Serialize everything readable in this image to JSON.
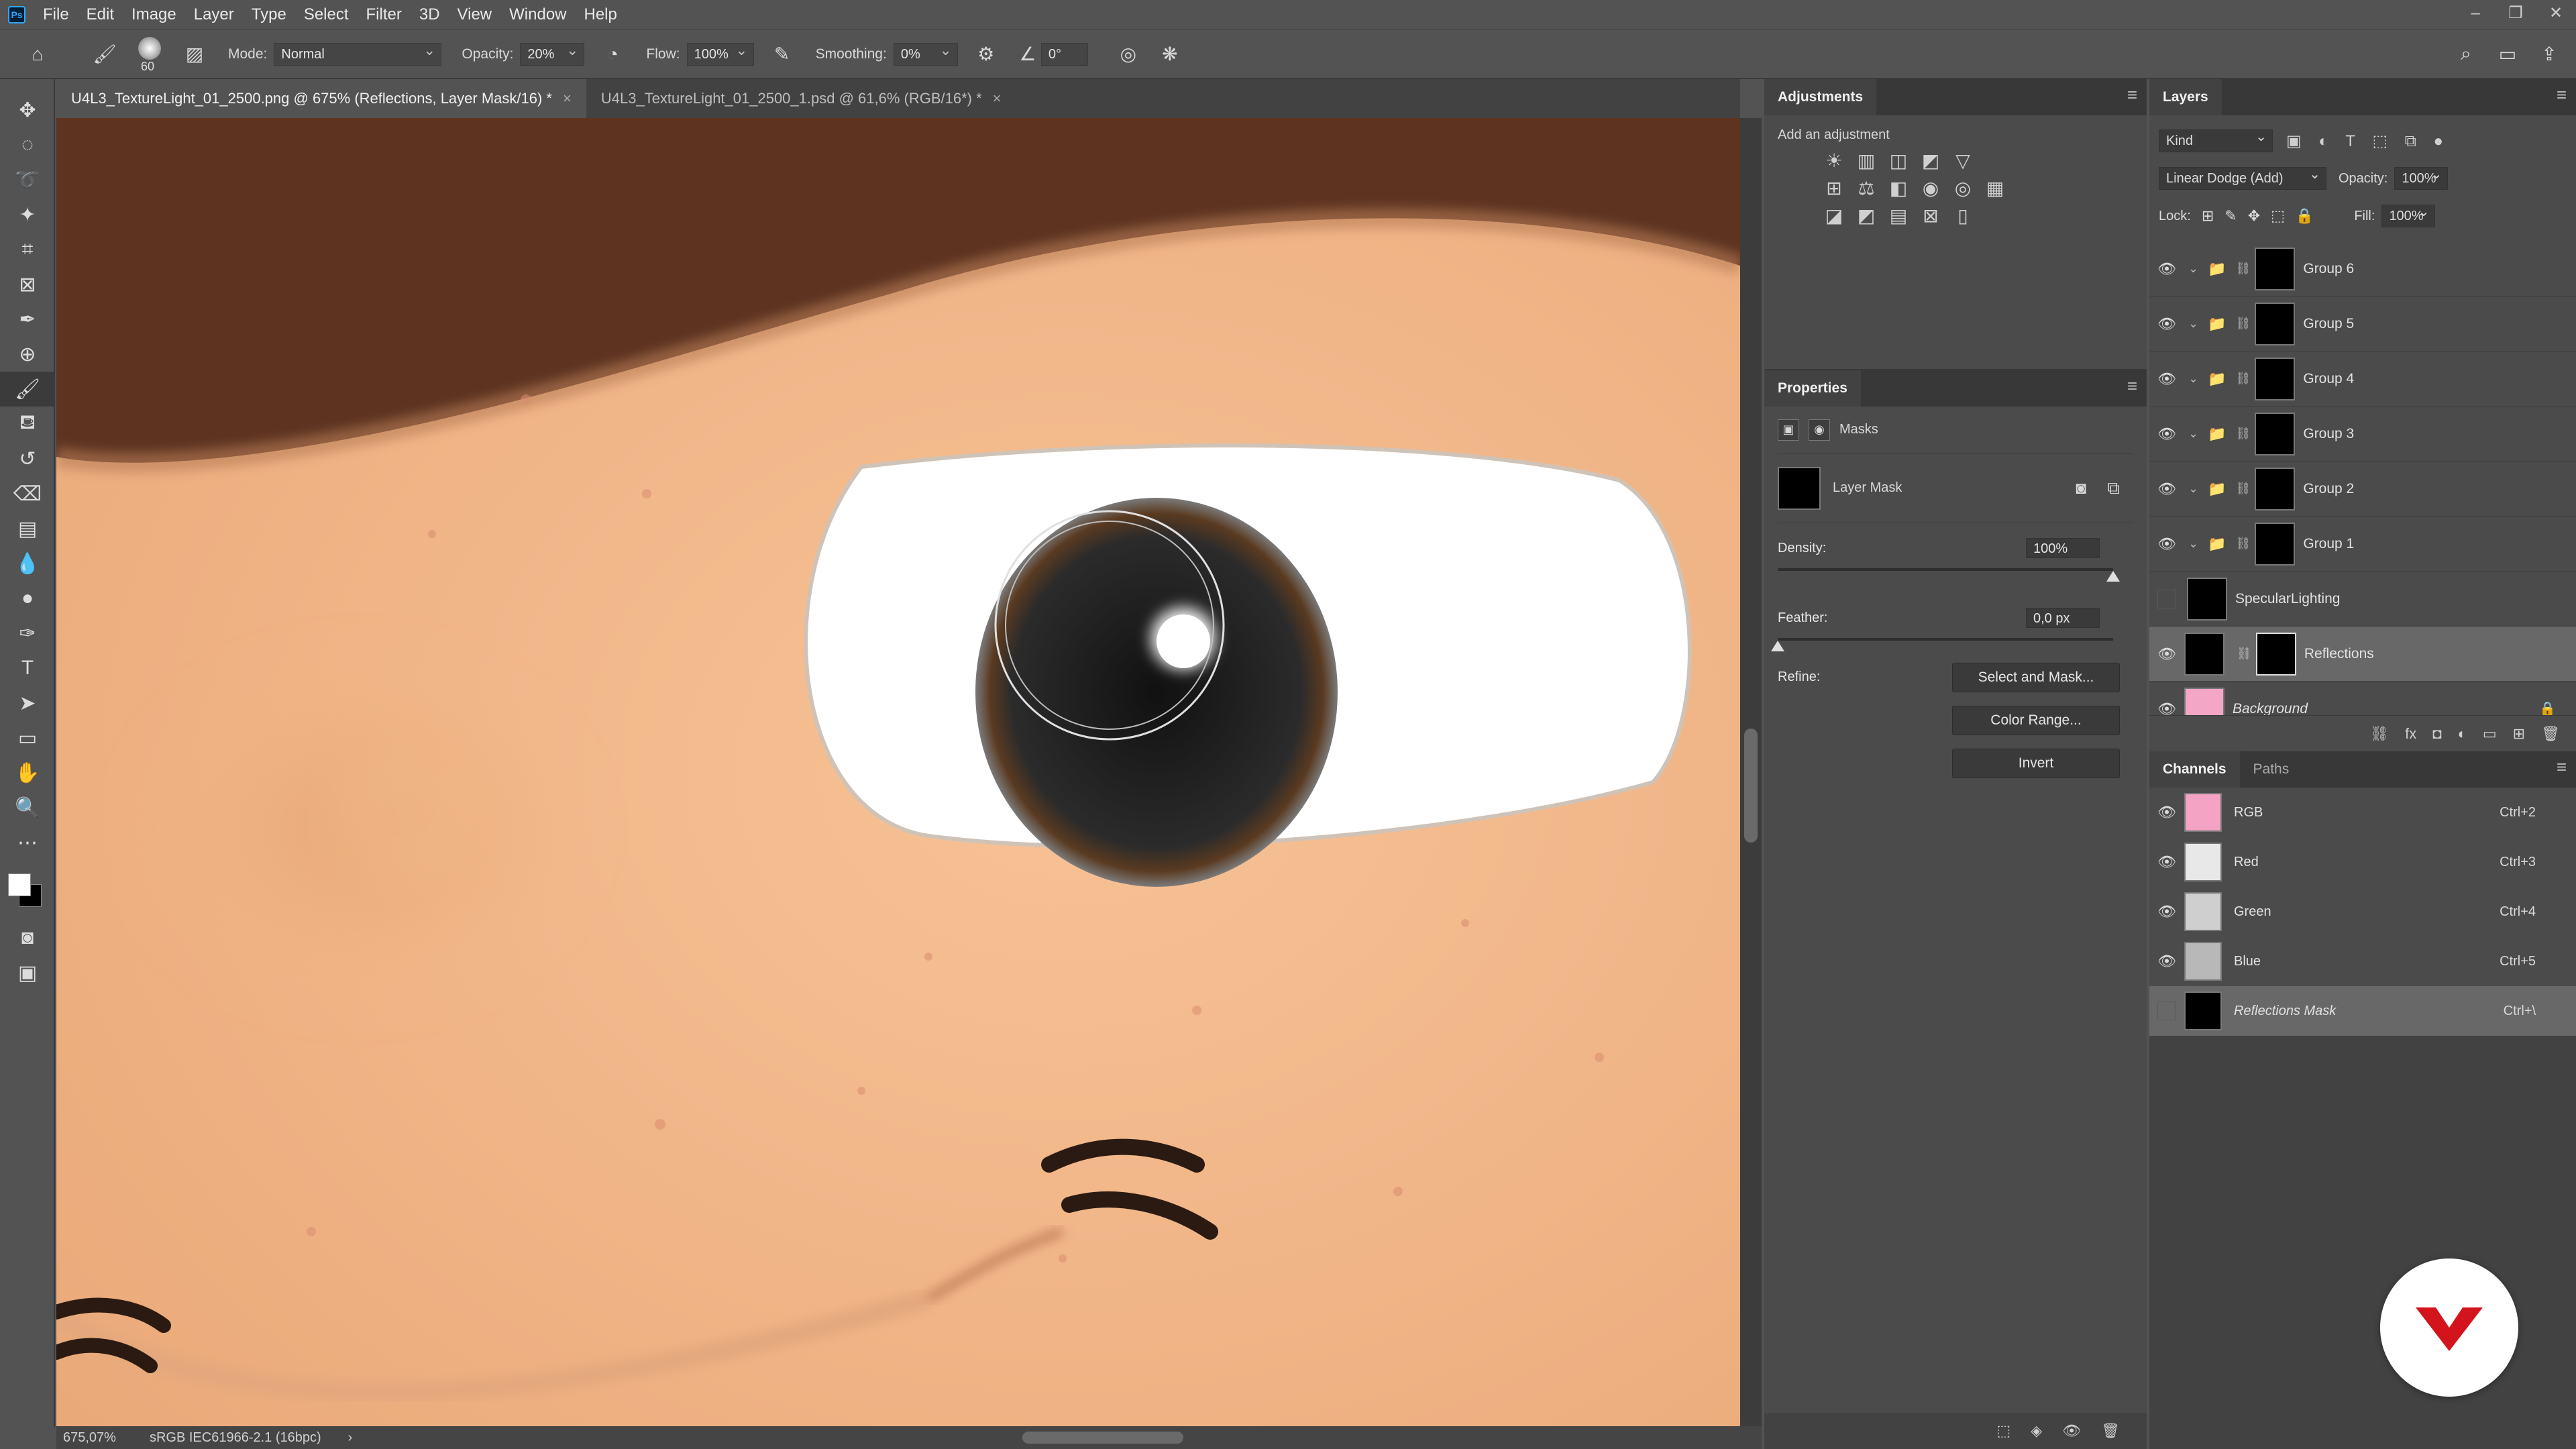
{
  "app": {
    "logo": "Ps"
  },
  "menu": [
    "File",
    "Edit",
    "Image",
    "Layer",
    "Type",
    "Select",
    "Filter",
    "3D",
    "View",
    "Window",
    "Help"
  ],
  "window_controls": [
    "–",
    "❐",
    "✕"
  ],
  "options": {
    "brush_size": "60",
    "mode_label": "Mode:",
    "mode_value": "Normal",
    "opacity_label": "Opacity:",
    "opacity_value": "20%",
    "flow_label": "Flow:",
    "flow_value": "100%",
    "smoothing_label": "Smoothing:",
    "smoothing_value": "0%",
    "angle_value": "0°"
  },
  "tabs": [
    {
      "label": "U4L3_TextureLight_01_2500.png @ 675% (Reflections, Layer Mask/16) *",
      "close": "×"
    },
    {
      "label": "U4L3_TextureLight_01_2500_1.psd @ 61,6% (RGB/16*) *",
      "close": "×"
    }
  ],
  "status": {
    "zoom": "675,07%",
    "profile": "sRGB IEC61966-2.1 (16bpc)",
    "arrow": "›"
  },
  "adjustments": {
    "title": "Adjustments",
    "caption": "Add an adjustment",
    "icons": [
      "☀",
      "▥",
      "◫",
      "◩",
      "▽",
      "⊞",
      "⚖",
      "◧",
      "◉",
      "◎",
      "▦",
      "◪",
      "◩",
      "▤",
      "⊠",
      "▯"
    ]
  },
  "properties": {
    "title": "Properties",
    "masks_label": "Masks",
    "layer_mask_label": "Layer Mask",
    "density_label": "Density:",
    "density_value": "100%",
    "density_level": 1.0,
    "feather_label": "Feather:",
    "feather_value": "0,0 px",
    "feather_level": 0.0,
    "refine_label": "Refine:",
    "buttons": [
      "Select and Mask...",
      "Color Range...",
      "Invert"
    ]
  },
  "layers_panel": {
    "title": "Layers",
    "kind_label": "Kind",
    "blend_mode": "Linear Dodge (Add)",
    "opacity_label": "Opacity:",
    "opacity_value": "100%",
    "lock_label": "Lock:",
    "fill_label": "Fill:",
    "fill_value": "100%",
    "layers": [
      {
        "name": "Group 6",
        "type": "group",
        "visible": true
      },
      {
        "name": "Group 5",
        "type": "group",
        "visible": true
      },
      {
        "name": "Group 4",
        "type": "group",
        "visible": true
      },
      {
        "name": "Group 3",
        "type": "group",
        "visible": true
      },
      {
        "name": "Group 2",
        "type": "group",
        "visible": true
      },
      {
        "name": "Group 1",
        "type": "group",
        "visible": true
      },
      {
        "name": "SpecularLighting",
        "type": "layer",
        "visible": false
      },
      {
        "name": "Reflections",
        "type": "masked",
        "visible": true,
        "selected": true
      },
      {
        "name": "Background",
        "type": "background",
        "visible": true
      }
    ],
    "footer_icons": [
      "⛓",
      "fx",
      "◘",
      "◐",
      "▭",
      "⊞",
      "🗑"
    ]
  },
  "channels_panel": {
    "tabs": [
      "Channels",
      "Paths"
    ],
    "channels": [
      {
        "name": "RGB",
        "shortcut": "Ctrl+2",
        "color": "#f4a3c4"
      },
      {
        "name": "Red",
        "shortcut": "Ctrl+3",
        "color": "#e8e8e8"
      },
      {
        "name": "Green",
        "shortcut": "Ctrl+4",
        "color": "#cfcfcf"
      },
      {
        "name": "Blue",
        "shortcut": "Ctrl+5",
        "color": "#b8b8b8"
      },
      {
        "name": "Reflections Mask",
        "shortcut": "Ctrl+\\",
        "color": "#000000"
      }
    ]
  },
  "colors": {
    "skin": "#f3b987",
    "hair": "#5e3421",
    "iris": "#1e1e1e",
    "fg_color": "#ffffff",
    "bg_color": "#000000",
    "brand_red": "#d4141c"
  }
}
